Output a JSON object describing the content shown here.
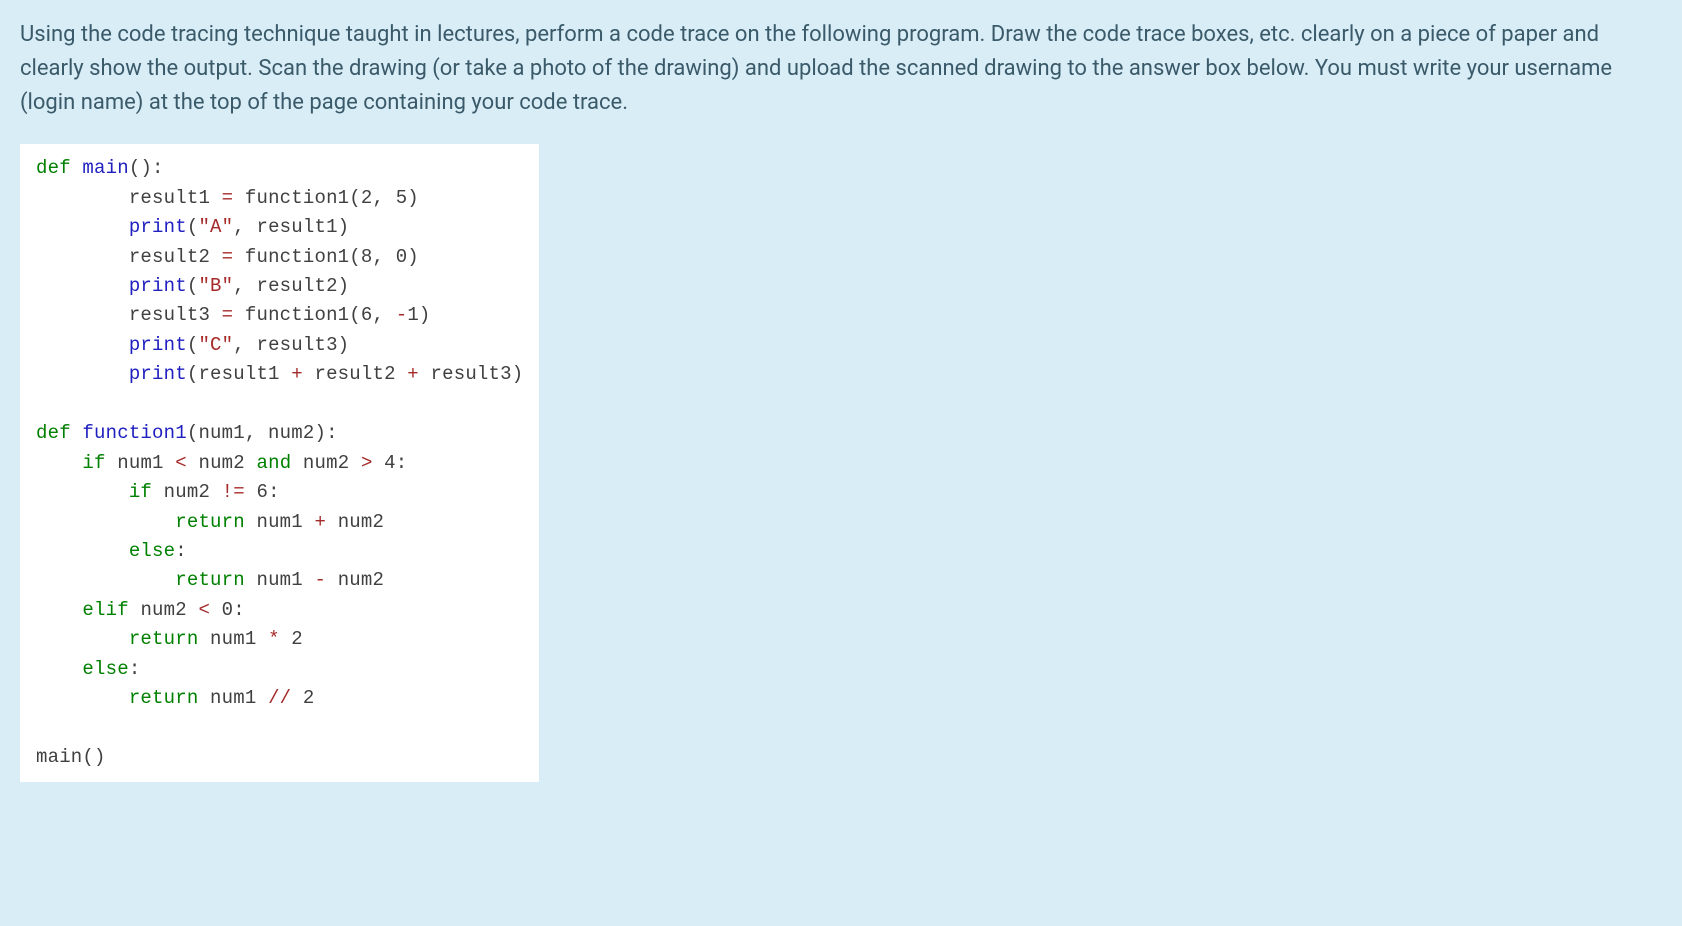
{
  "question": {
    "text": "Using the code tracing technique taught in lectures, perform a code trace on the following program. Draw the code trace boxes, etc. clearly on a piece of paper and clearly show the output. Scan the drawing (or take a photo of the drawing) and upload the scanned drawing to the answer box below. You must write your username (login name) at the top of the page containing your code trace."
  },
  "code": {
    "lines": [
      {
        "t": "plain",
        "pre": "",
        "tokens": [
          {
            "c": "kw",
            "v": "def"
          },
          {
            "c": "",
            "v": " "
          },
          {
            "c": "fn",
            "v": "main"
          },
          {
            "c": "",
            "v": "():"
          }
        ]
      },
      {
        "t": "plain",
        "pre": "        ",
        "tokens": [
          {
            "c": "",
            "v": "result1 "
          },
          {
            "c": "op",
            "v": "="
          },
          {
            "c": "",
            "v": " function1(2, 5)"
          }
        ]
      },
      {
        "t": "plain",
        "pre": "        ",
        "tokens": [
          {
            "c": "fn",
            "v": "print"
          },
          {
            "c": "",
            "v": "("
          },
          {
            "c": "str",
            "v": "\"A\""
          },
          {
            "c": "",
            "v": ", result1)"
          }
        ]
      },
      {
        "t": "plain",
        "pre": "        ",
        "tokens": [
          {
            "c": "",
            "v": "result2 "
          },
          {
            "c": "op",
            "v": "="
          },
          {
            "c": "",
            "v": " function1(8, 0)"
          }
        ]
      },
      {
        "t": "plain",
        "pre": "        ",
        "tokens": [
          {
            "c": "fn",
            "v": "print"
          },
          {
            "c": "",
            "v": "("
          },
          {
            "c": "str",
            "v": "\"B\""
          },
          {
            "c": "",
            "v": ", result2)"
          }
        ]
      },
      {
        "t": "plain",
        "pre": "        ",
        "tokens": [
          {
            "c": "",
            "v": "result3 "
          },
          {
            "c": "op",
            "v": "="
          },
          {
            "c": "",
            "v": " function1(6, "
          },
          {
            "c": "op",
            "v": "-"
          },
          {
            "c": "",
            "v": "1)"
          }
        ]
      },
      {
        "t": "plain",
        "pre": "        ",
        "tokens": [
          {
            "c": "fn",
            "v": "print"
          },
          {
            "c": "",
            "v": "("
          },
          {
            "c": "str",
            "v": "\"C\""
          },
          {
            "c": "",
            "v": ", result3)"
          }
        ]
      },
      {
        "t": "plain",
        "pre": "        ",
        "tokens": [
          {
            "c": "fn",
            "v": "print"
          },
          {
            "c": "",
            "v": "(result1 "
          },
          {
            "c": "op",
            "v": "+"
          },
          {
            "c": "",
            "v": " result2 "
          },
          {
            "c": "op",
            "v": "+"
          },
          {
            "c": "",
            "v": " result3)"
          }
        ]
      },
      {
        "t": "blank"
      },
      {
        "t": "plain",
        "pre": "",
        "tokens": [
          {
            "c": "kw",
            "v": "def"
          },
          {
            "c": "",
            "v": " "
          },
          {
            "c": "fn",
            "v": "function1"
          },
          {
            "c": "",
            "v": "(num1, num2):"
          }
        ]
      },
      {
        "t": "plain",
        "pre": "    ",
        "tokens": [
          {
            "c": "kw",
            "v": "if"
          },
          {
            "c": "",
            "v": " num1 "
          },
          {
            "c": "op",
            "v": "<"
          },
          {
            "c": "",
            "v": " num2 "
          },
          {
            "c": "kw",
            "v": "and"
          },
          {
            "c": "",
            "v": " num2 "
          },
          {
            "c": "op",
            "v": ">"
          },
          {
            "c": "",
            "v": " 4:"
          }
        ]
      },
      {
        "t": "plain",
        "pre": "        ",
        "tokens": [
          {
            "c": "kw",
            "v": "if"
          },
          {
            "c": "",
            "v": " num2 "
          },
          {
            "c": "op",
            "v": "!="
          },
          {
            "c": "",
            "v": " 6:"
          }
        ]
      },
      {
        "t": "plain",
        "pre": "            ",
        "tokens": [
          {
            "c": "kw",
            "v": "return"
          },
          {
            "c": "",
            "v": " num1 "
          },
          {
            "c": "op",
            "v": "+"
          },
          {
            "c": "",
            "v": " num2"
          }
        ]
      },
      {
        "t": "plain",
        "pre": "        ",
        "tokens": [
          {
            "c": "kw",
            "v": "else"
          },
          {
            "c": "",
            "v": ":"
          }
        ]
      },
      {
        "t": "plain",
        "pre": "            ",
        "tokens": [
          {
            "c": "kw",
            "v": "return"
          },
          {
            "c": "",
            "v": " num1 "
          },
          {
            "c": "op",
            "v": "-"
          },
          {
            "c": "",
            "v": " num2"
          }
        ]
      },
      {
        "t": "plain",
        "pre": "    ",
        "tokens": [
          {
            "c": "kw",
            "v": "elif"
          },
          {
            "c": "",
            "v": " num2 "
          },
          {
            "c": "op",
            "v": "<"
          },
          {
            "c": "",
            "v": " 0:"
          }
        ]
      },
      {
        "t": "plain",
        "pre": "        ",
        "tokens": [
          {
            "c": "kw",
            "v": "return"
          },
          {
            "c": "",
            "v": " num1 "
          },
          {
            "c": "op",
            "v": "*"
          },
          {
            "c": "",
            "v": " 2"
          }
        ]
      },
      {
        "t": "plain",
        "pre": "    ",
        "tokens": [
          {
            "c": "kw",
            "v": "else"
          },
          {
            "c": "",
            "v": ":"
          }
        ]
      },
      {
        "t": "plain",
        "pre": "        ",
        "tokens": [
          {
            "c": "kw",
            "v": "return"
          },
          {
            "c": "",
            "v": " num1 "
          },
          {
            "c": "op",
            "v": "//"
          },
          {
            "c": "",
            "v": " 2"
          }
        ]
      },
      {
        "t": "blank"
      },
      {
        "t": "plain",
        "pre": "",
        "tokens": [
          {
            "c": "",
            "v": "main()"
          }
        ]
      }
    ]
  }
}
